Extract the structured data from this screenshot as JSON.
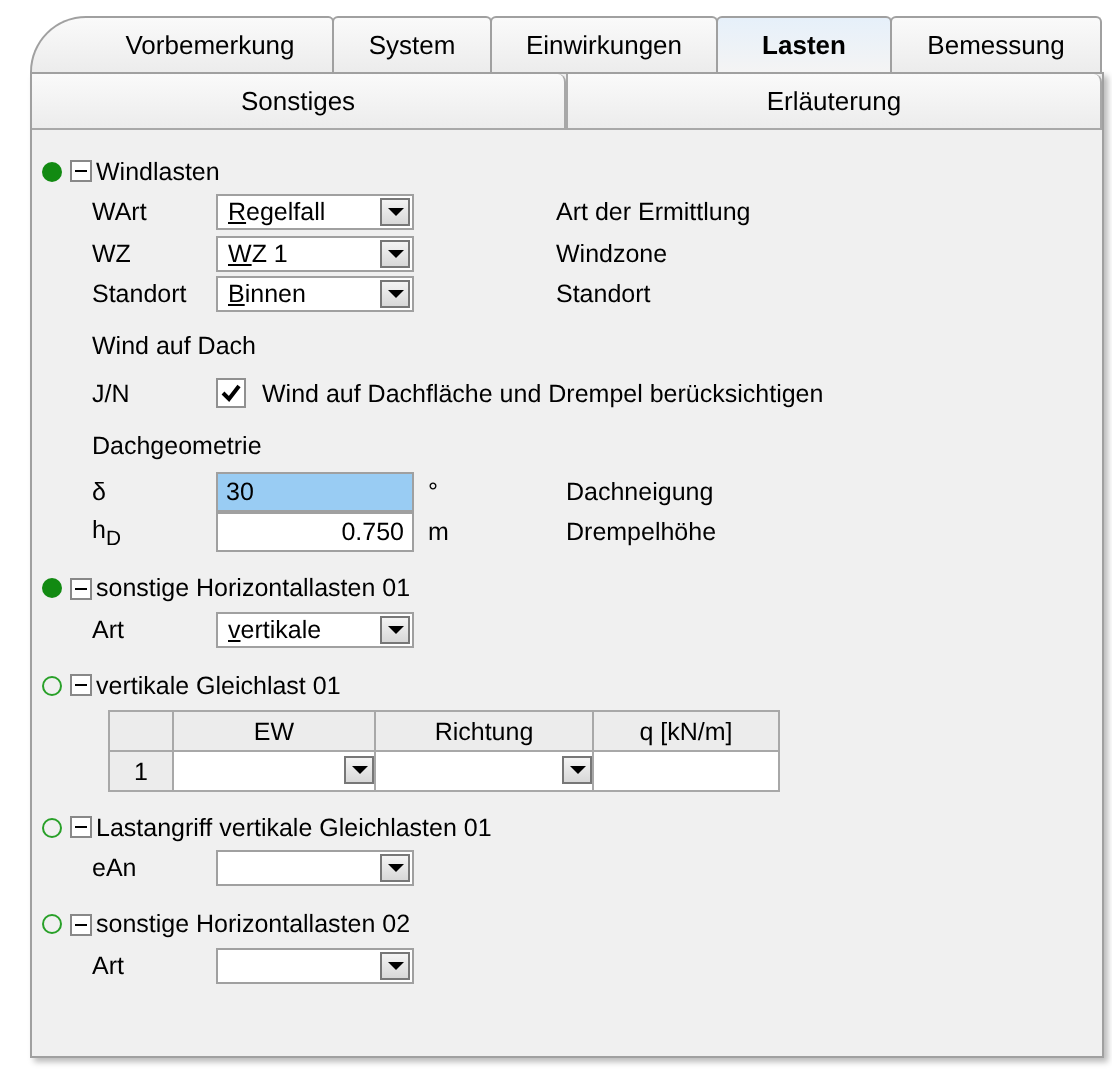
{
  "tabs": [
    {
      "label": "Vorbemerkung",
      "selected": false
    },
    {
      "label": "System",
      "selected": false
    },
    {
      "label": "Einwirkungen",
      "selected": false
    },
    {
      "label": "Lasten",
      "selected": true
    },
    {
      "label": "Bemessung",
      "selected": false
    }
  ],
  "subtabs": [
    {
      "label": "Sonstiges",
      "selected": false
    },
    {
      "label": "Erläuterung",
      "selected": false
    }
  ],
  "sections": [
    {
      "title": "Windlasten",
      "complete": true,
      "expanded": true,
      "rows": [
        {
          "kind": "combo",
          "label": "WArt",
          "value": "Regelfall",
          "description": "Art der Ermittlung"
        },
        {
          "kind": "combo",
          "label": "WZ",
          "value": "WZ 1",
          "description": "Windzone"
        },
        {
          "kind": "combo",
          "label": "Standort",
          "value": "Binnen",
          "description": "Standort"
        },
        {
          "kind": "heading",
          "label": "Wind auf Dach"
        },
        {
          "kind": "checkbox",
          "label": "J/N",
          "checked": true,
          "description": "Wind auf Dachfläche und Drempel berücksichtigen"
        },
        {
          "kind": "heading",
          "label": "Dachgeometrie"
        },
        {
          "kind": "number",
          "label": "δ",
          "value": "30",
          "selected": true,
          "unit": "°",
          "description": "Dachneigung"
        },
        {
          "kind": "number",
          "label": "h$_{D}$",
          "value": "0.750",
          "selected": false,
          "unit": "m",
          "description": "Drempelhöhe"
        }
      ]
    },
    {
      "title": "sonstige Horizontallasten 01",
      "complete": true,
      "expanded": true,
      "rows": [
        {
          "kind": "combo",
          "label": "Art",
          "value": "vertikale"
        }
      ]
    },
    {
      "title": "vertikale Gleichlast 01",
      "complete": false,
      "expanded": true,
      "rows": [
        {
          "kind": "table",
          "columns": [
            "EW",
            "Richtung",
            "q [kN/m]"
          ],
          "rows": [
            {
              "index": "1"
            }
          ]
        }
      ]
    },
    {
      "title": "Lastangriff vertikale Gleichlasten 01",
      "complete": false,
      "expanded": true,
      "rows": [
        {
          "kind": "combo",
          "label": "eAn"
        }
      ]
    },
    {
      "title": "sonstige Horizontallasten 02",
      "complete": false,
      "expanded": true,
      "rows": [
        {
          "kind": "combo",
          "label": "Art"
        }
      ]
    }
  ]
}
